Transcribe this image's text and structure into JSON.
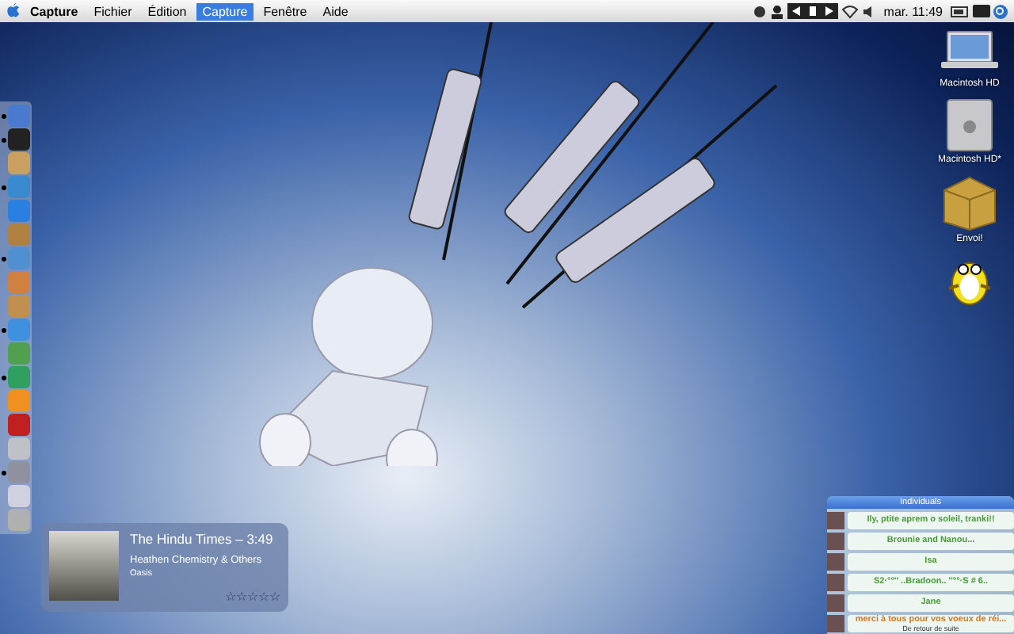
{
  "menu_bar": {
    "app": "Capture",
    "items": [
      {
        "label": "Fichier",
        "selected": false
      },
      {
        "label": "Édition",
        "selected": false
      },
      {
        "label": "Capture",
        "selected": true
      },
      {
        "label": "Fenêtre",
        "selected": false
      },
      {
        "label": "Aide",
        "selected": false
      }
    ],
    "clock": "mar. 11:49"
  },
  "desktop_icons": [
    {
      "kind": "laptop",
      "label": "Macintosh HD"
    },
    {
      "kind": "cube",
      "label": "Macintosh HD*"
    },
    {
      "kind": "box",
      "label": "Envoi!"
    },
    {
      "kind": "penguin"
    }
  ],
  "dock": {
    "items": [
      {
        "running": true
      },
      {
        "running": true
      },
      {
        "running": false
      },
      {
        "running": true
      },
      {
        "running": false
      },
      {
        "running": false
      },
      {
        "running": true
      },
      {
        "running": false
      },
      {
        "running": false
      },
      {
        "running": true
      },
      {
        "running": false
      },
      {
        "running": true
      },
      {
        "running": false
      },
      {
        "running": false
      },
      {
        "running": false
      },
      {
        "running": true
      },
      {
        "running": false
      },
      {
        "running": false
      }
    ]
  },
  "now_playing": {
    "title": "The Hindu Times – 3:49",
    "album": "Heathen Chemistry & Others",
    "artist": "Oasis",
    "stars": 0
  },
  "buddy_list": {
    "title": "Individuals",
    "buddies": [
      {
        "message": "Ily, ptite aprem o soleil, tranki!!",
        "color": "#4a9a3a"
      },
      {
        "message": "Brounie and Nanou...",
        "color": "#4a9a3a"
      },
      {
        "message": "Isa",
        "color": "#4a9a3a"
      },
      {
        "message": "S2·°°'' ..Bradoon.. ''°°·S    # 6..",
        "color": "#4a9a3a"
      },
      {
        "message": "Jane",
        "color": "#4a9a3a"
      },
      {
        "message": "merci à tous pour vos voeux de réi...",
        "color": "#d07a20",
        "status": "De retour de suite"
      }
    ]
  }
}
